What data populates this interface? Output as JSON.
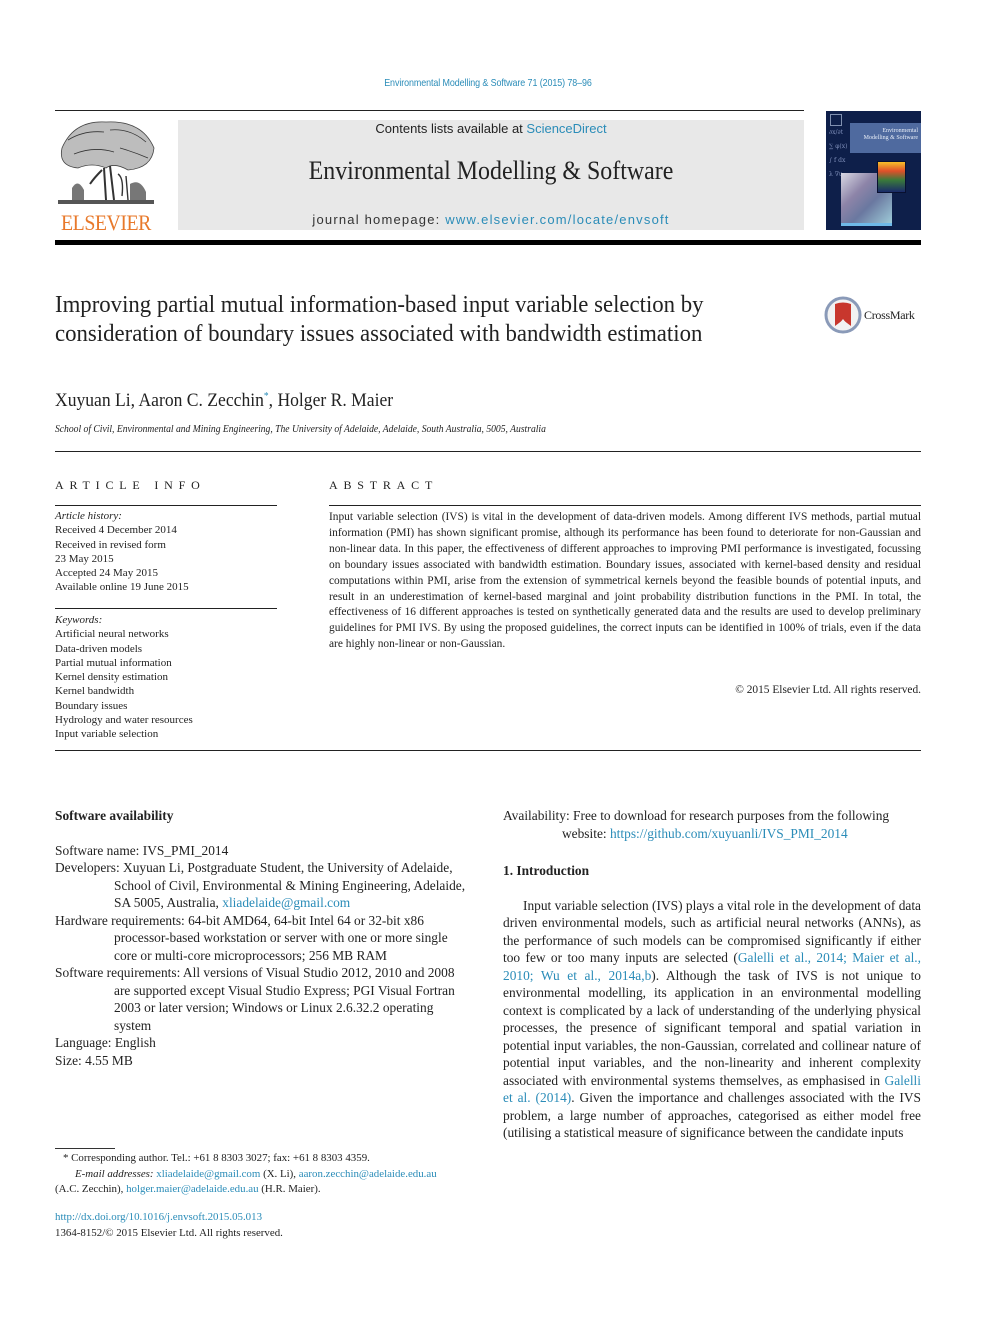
{
  "journal_ref": "Environmental Modelling & Software 71 (2015) 78–96",
  "header": {
    "publisher_logo_text": "ELSEVIER",
    "contents_prefix": "Contents lists available at ",
    "contents_link": "ScienceDirect",
    "journal_title": "Environmental Modelling & Software",
    "homepage_prefix": "journal homepage: ",
    "homepage_link": "www.elsevier.com/locate/envsoft",
    "cover_title_line1": "Environmental",
    "cover_title_line2": "Modelling & Software"
  },
  "paper": {
    "title": "Improving partial mutual information-based input variable selection by consideration of boundary issues associated with bandwidth estimation",
    "crossmark_label": "CrossMark",
    "authors": [
      {
        "name": "Xuyuan Li",
        "mark": ""
      },
      {
        "name": "Aaron C. Zecchin",
        "mark": "*"
      },
      {
        "name": "Holger R. Maier",
        "mark": ""
      }
    ],
    "author_sep": ", ",
    "affiliation": "School of Civil, Environmental and Mining Engineering, The University of Adelaide, Adelaide, South Australia, 5005, Australia"
  },
  "article_info": {
    "heading": "ARTICLE INFO",
    "history_label": "Article history:",
    "history": [
      "Received 4 December 2014",
      "Received in revised form",
      "23 May 2015",
      "Accepted 24 May 2015",
      "Available online 19 June 2015"
    ],
    "keywords_label": "Keywords:",
    "keywords": [
      "Artificial neural networks",
      "Data-driven models",
      "Partial mutual information",
      "Kernel density estimation",
      "Kernel bandwidth",
      "Boundary issues",
      "Hydrology and water resources",
      "Input variable selection"
    ]
  },
  "abstract": {
    "heading": "ABSTRACT",
    "text": "Input variable selection (IVS) is vital in the development of data-driven models. Among different IVS methods, partial mutual information (PMI) has shown significant promise, although its performance has been found to deteriorate for non-Gaussian and non-linear data. In this paper, the effectiveness of different approaches to improving PMI performance is investigated, focussing on boundary issues associated with bandwidth estimation. Boundary issues, associated with kernel-based density and re­sidual computations within PMI, arise from the extension of symmetrical kernels beyond the feasible bounds of potential inputs, and result in an underestimation of kernel-based marginal and joint prob­ability distribution functions in the PMI. In total, the effectiveness of 16 different approaches is tested on synthetically generated data and the results are used to develop preliminary guidelines for PMI IVS. By using the proposed guidelines, the correct inputs can be identified in 100% of trials, even if the data are highly non-linear or non-Gaussian.",
    "copyright": "© 2015 Elsevier Ltd. All rights reserved."
  },
  "software": {
    "heading": "Software availability",
    "name_label": "Software name: ",
    "name_value": "IVS_PMI_2014",
    "developers_label": "Developers: ",
    "developers_value": "Xuyuan Li, Postgraduate Student, the University of Adelaide, School of Civil, Environmental & Mining Engineering, Adelaide, SA 5005, Australia, ",
    "developers_email": "xliadelaide@gmail.com",
    "hardware_label": "Hardware requirements: ",
    "hardware_value": "64-bit AMD64, 64-bit Intel 64 or 32-bit x86 processor-based workstation or server with one or more single core or multi-core microprocessors; 256 MB RAM",
    "software_label": "Software requirements: ",
    "software_value": "All versions of Visual Studio 2012, 2010 and 2008 are supported except Visual Studio Express; PGI Visual Fortran 2003 or later version; Windows or Linux 2.6.32.2 operating system",
    "language_label": "Language: ",
    "language_value": "English",
    "size_label": "Size: ",
    "size_value": "4.55 MB",
    "availability_label": "Availability: ",
    "availability_value": "Free to download for research purposes from the following website: ",
    "availability_link": "https://github.com/xuyuanli/IVS_PMI_2014"
  },
  "introduction": {
    "heading": "1.  Introduction",
    "p1_a": "Input variable selection (IVS) plays a vital role in the develop­ment of data driven environmental models, such as artificial neural networks (ANNs), as the performance of such models can be compromised significantly if either too few or too many inputs are selected (",
    "p1_cite1": "Galelli et al., 2014; Maier et al., 2010; Wu et al., 2014a,b",
    "p1_b": "). Although the task of IVS is not unique to environmental modelling, its application in an environmental modelling context is compli­cated by a lack of understanding of the underlying physical pro­cesses, the presence of significant temporal and spatial variation in potential input variables, the non-Gaussian, correlated and collinear nature of potential input variables, and the non-linearity and inherent complexity associated with environmental systems themselves, as emphasised in ",
    "p1_cite2": "Galelli et al. (2014)",
    "p1_c": ". Given the importance and challenges associated with the IVS problem, a large number of approaches, categorised as either model free (utilising a statistical measure of significance between the candidate inputs"
  },
  "footnote": {
    "corresponding": "* Corresponding author. Tel.: +61 8 8303 3027; fax: +61 8 8303 4359.",
    "email_label": "E-mail addresses: ",
    "email1": "xliadelaide@gmail.com",
    "email1_owner": " (X. Li), ",
    "email2": "aaron.zecchin@adelaide.edu.au",
    "email2_owner": "(A.C. Zecchin), ",
    "email3": "holger.maier@adelaide.edu.au",
    "email3_owner": " (H.R. Maier)."
  },
  "doi": {
    "link": "http://dx.doi.org/10.1016/j.envsoft.2015.05.013",
    "issn_line": "1364-8152/© 2015 Elsevier Ltd. All rights reserved."
  },
  "colors": {
    "link": "#2a8cb8",
    "elsevier_orange": "#e8792b",
    "banner_grey": "#e8e8e8",
    "cover_navy": "#0e1f4a"
  }
}
